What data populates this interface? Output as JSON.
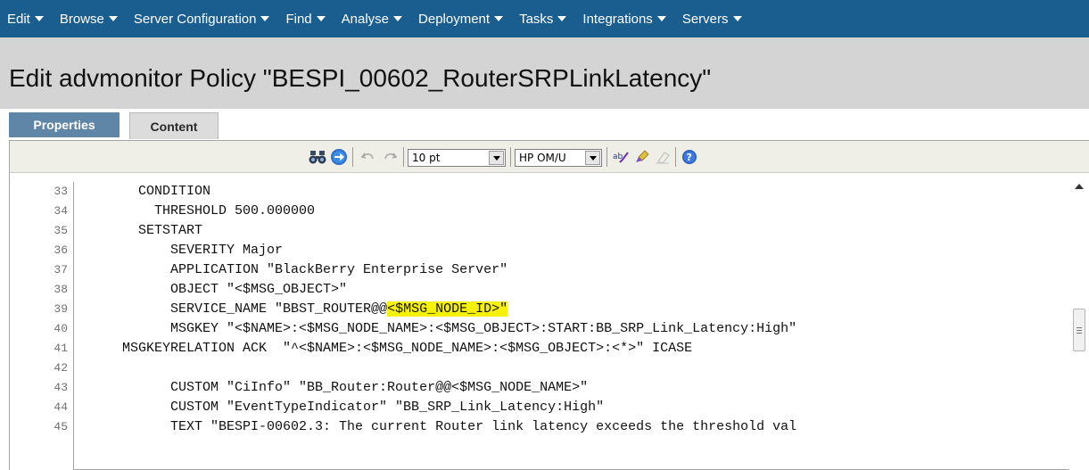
{
  "menu": {
    "items": [
      {
        "label": "Edit"
      },
      {
        "label": "Browse"
      },
      {
        "label": "Server Configuration"
      },
      {
        "label": "Find"
      },
      {
        "label": "Analyse"
      },
      {
        "label": "Deployment"
      },
      {
        "label": "Tasks"
      },
      {
        "label": "Integrations"
      },
      {
        "label": "Servers"
      }
    ]
  },
  "page": {
    "title": "Edit advmonitor Policy \"BESPI_00602_RouterSRPLinkLatency\""
  },
  "tabs": {
    "properties": "Properties",
    "content": "Content",
    "active": "Content"
  },
  "toolbar": {
    "font_size": "10 pt",
    "syntax_mode": "HP OM/U",
    "icons": [
      "find-icon",
      "goto-icon",
      "undo-icon",
      "redo-icon",
      "spellcheck-icon",
      "format-icon",
      "eraser-icon",
      "help-icon"
    ]
  },
  "editor": {
    "lines": [
      {
        "num": "33",
        "text": "        CONDITION"
      },
      {
        "num": "34",
        "text": "          THRESHOLD 500.000000"
      },
      {
        "num": "35",
        "text": "        SETSTART"
      },
      {
        "num": "36",
        "text": "            SEVERITY Major"
      },
      {
        "num": "37",
        "text": "            APPLICATION \"BlackBerry Enterprise Server\""
      },
      {
        "num": "38",
        "text": "            OBJECT \"<$MSG_OBJECT>\""
      },
      {
        "num": "39",
        "text": "            SERVICE_NAME \"BBST_ROUTER@@",
        "highlight": "<$MSG_NODE_ID>\""
      },
      {
        "num": "40",
        "text": "            MSGKEY \"<$NAME>:<$MSG_NODE_NAME>:<$MSG_OBJECT>:START:BB_SRP_Link_Latency:High\""
      },
      {
        "num": "41",
        "text": "      MSGKEYRELATION ACK  \"^<$NAME>:<$MSG_NODE_NAME>:<$MSG_OBJECT>:<*>\" ICASE"
      },
      {
        "num": "42",
        "text": ""
      },
      {
        "num": "43",
        "text": "            CUSTOM \"CiInfo\" \"BB_Router:Router@@<$MSG_NODE_NAME>\""
      },
      {
        "num": "44",
        "text": "            CUSTOM \"EventTypeIndicator\" \"BB_SRP_Link_Latency:High\""
      },
      {
        "num": "45",
        "text": "            TEXT \"BESPI-00602.3: The current Router link latency exceeds the threshold val"
      }
    ]
  },
  "colors": {
    "menubar": "#1a5d8f",
    "titlebar": "#d4d4d4",
    "highlight": "#f6f10a"
  }
}
